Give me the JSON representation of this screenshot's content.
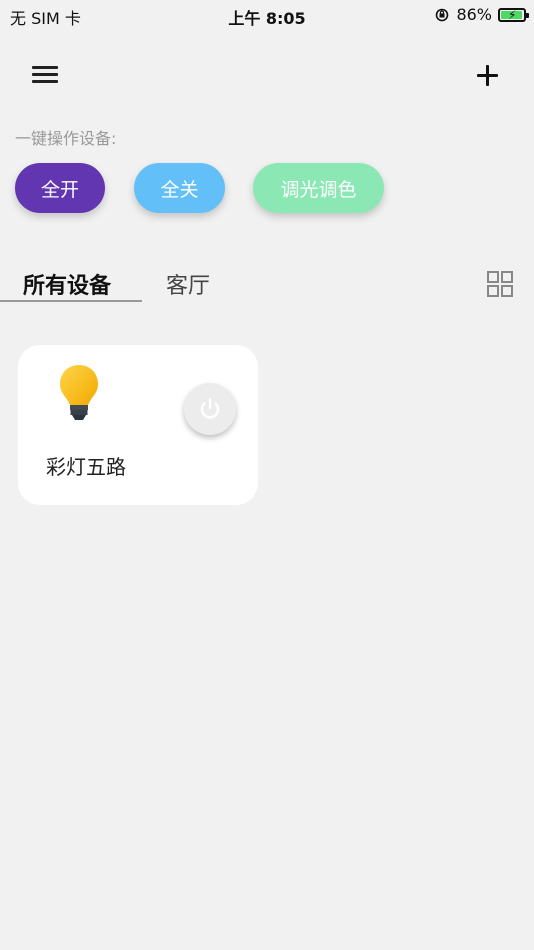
{
  "status_bar": {
    "carrier": "无 SIM 卡",
    "time": "上午 8:05",
    "battery": "86%",
    "battery_level": 0.86
  },
  "header": {
    "menu_icon": "hamburger-menu-icon",
    "add_icon": "plus-icon"
  },
  "quick_actions": {
    "label": "一键操作设备:",
    "all_on": "全开",
    "all_off": "全关",
    "dimming": "调光调色",
    "colors": {
      "all_on": "#6236b0",
      "all_off": "#63bff8",
      "dimming": "#8be8b5"
    }
  },
  "tabs": [
    {
      "label": "所有设备",
      "active": true
    },
    {
      "label": "客厅",
      "active": false
    }
  ],
  "view_toggle_icon": "grid-view-icon",
  "devices": [
    {
      "name": "彩灯五路",
      "icon": "light-bulb-icon",
      "power": "off"
    }
  ]
}
